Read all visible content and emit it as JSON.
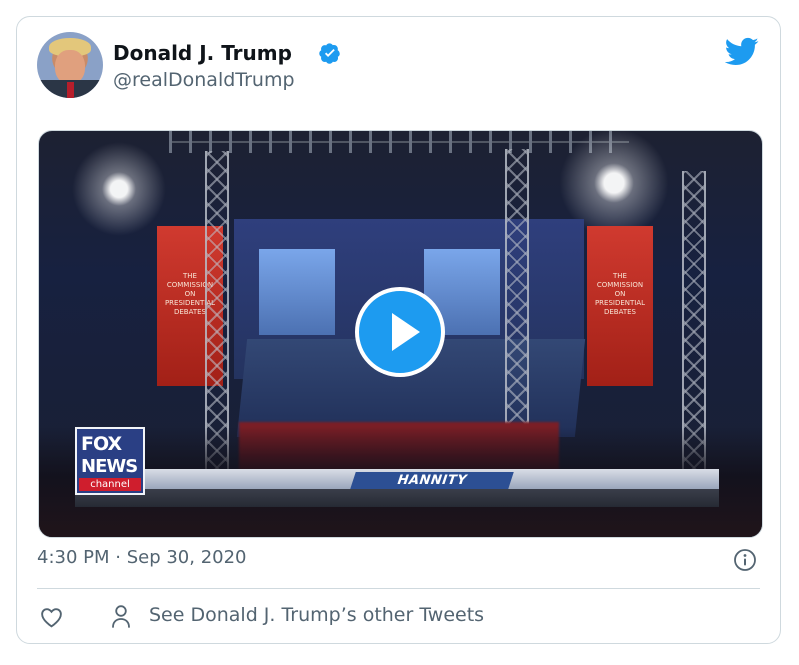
{
  "tweet": {
    "author": {
      "name": "Donald J. Trump",
      "handle": "@realDonaldTrump",
      "verified": true,
      "avatar": "avatar"
    },
    "brand_icon": "twitter-bird-icon",
    "media": {
      "type": "video",
      "overlay": {
        "network_top": "FOX",
        "network_mid": "NEWS",
        "network_bottom": "channel",
        "show": "HANNITY"
      },
      "banners": [
        "THE\nCOMMISSION\nON\nPRESIDENTIAL\nDEBATES",
        "THE\nCOMMISSION\nON\nPRESIDENTIAL\nDEBATES"
      ],
      "play_icon": "play-icon"
    },
    "timestamp": "4:30 PM · Sep 30, 2020",
    "info_icon": "info-icon",
    "actions": {
      "like_icon": "heart-icon",
      "profile_icon": "person-icon",
      "other_tweets_label": "See Donald J. Trump’s other Tweets"
    }
  },
  "colors": {
    "brand_blue": "#1d9bf0",
    "secondary_text": "#536471",
    "primary_text": "#0f1419"
  }
}
